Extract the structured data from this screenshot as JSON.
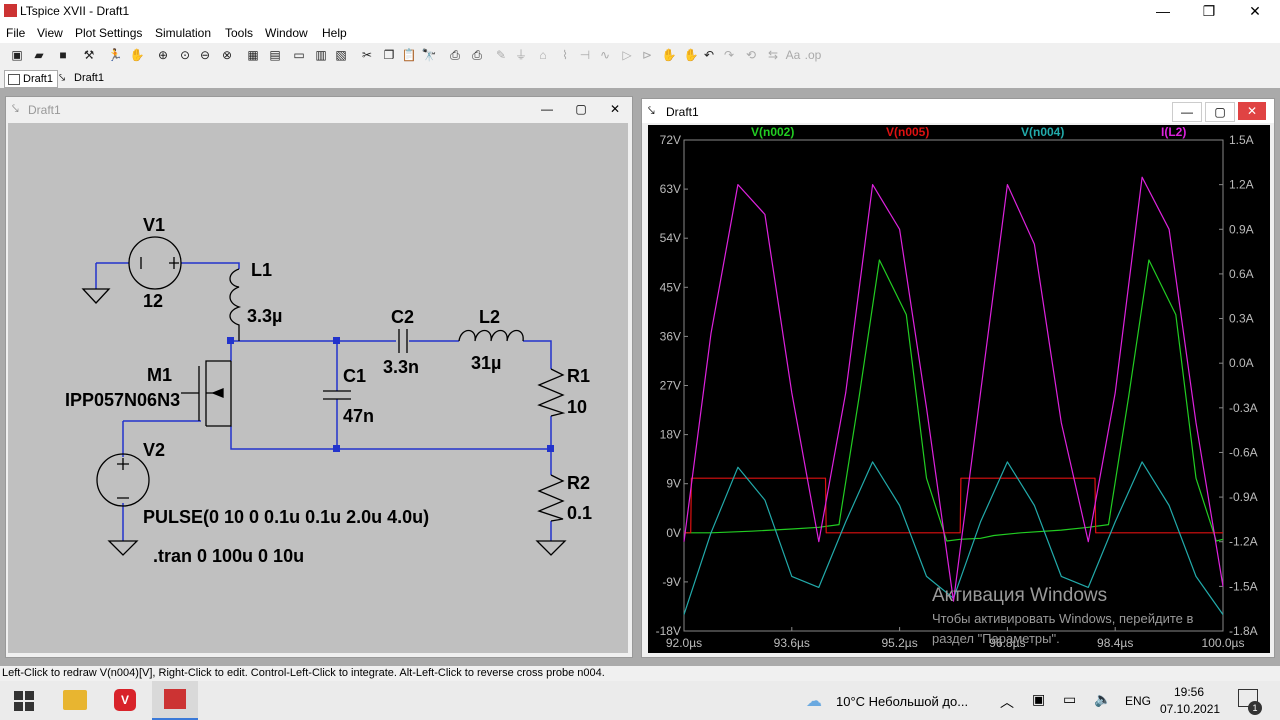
{
  "window": {
    "title": "LTspice XVII - Draft1",
    "min": "—",
    "max": "❐",
    "close": "✕"
  },
  "menu": [
    "File",
    "View",
    "Plot Settings",
    "Simulation",
    "Tools",
    "Window",
    "Help"
  ],
  "tabs": [
    "Draft1",
    "Draft1"
  ],
  "schematic_window": {
    "title": "Draft1",
    "min": "—",
    "max": "▢",
    "close": "✕"
  },
  "schematic": {
    "v1": {
      "name": "V1",
      "value": "12"
    },
    "l1": {
      "name": "L1",
      "value": "3.3µ"
    },
    "c2": {
      "name": "C2",
      "value": "3.3n"
    },
    "l2": {
      "name": "L2",
      "value": "31µ"
    },
    "m1": {
      "name": "M1",
      "value": "IPP057N06N3"
    },
    "c1": {
      "name": "C1",
      "value": "47n"
    },
    "r1": {
      "name": "R1",
      "value": "10"
    },
    "v2": {
      "name": "V2",
      "value": "PULSE(0 10 0 0.1u 0.1u 2.0u 4.0u)"
    },
    "r2": {
      "name": "R2",
      "value": "0.1"
    },
    "directive": ".tran 0 100u 0 10u"
  },
  "plot_window": {
    "title": "Draft1",
    "min": "—",
    "max": "▢",
    "close": "✕"
  },
  "chart_data": {
    "type": "line",
    "title": "",
    "xlabel": "",
    "ylabel": "",
    "xlim": [
      92.0,
      100.0
    ],
    "ylim": [
      -18,
      72
    ],
    "y2lim": [
      -1.8,
      1.5
    ],
    "x_ticks": [
      "92.0µs",
      "93.6µs",
      "95.2µs",
      "96.8µs",
      "98.4µs",
      "100.0µs"
    ],
    "y_ticks": [
      "72V",
      "63V",
      "54V",
      "45V",
      "36V",
      "27V",
      "18V",
      "9V",
      "0V",
      "-9V",
      "-18V"
    ],
    "y2_ticks": [
      "1.5A",
      "1.2A",
      "0.9A",
      "0.6A",
      "0.3A",
      "0.0A",
      "-0.3A",
      "-0.6A",
      "-0.9A",
      "-1.2A",
      "-1.5A",
      "-1.8A"
    ],
    "grid": false,
    "legend": "top",
    "series": [
      {
        "name": "V(n002)",
        "color": "#22cc22",
        "axis": "left",
        "x": [
          92.0,
          92.4,
          93.0,
          93.6,
          94.0,
          94.3,
          94.6,
          94.9,
          95.3,
          95.6,
          95.9,
          96.1,
          96.4,
          96.6,
          97.0,
          97.6,
          98.0,
          98.3,
          98.6,
          98.9,
          99.3,
          99.6,
          99.9,
          100.0
        ],
        "values": [
          0,
          0,
          0.3,
          0.7,
          1.0,
          1.5,
          25,
          50,
          40,
          10,
          -1.5,
          -1.2,
          -1.0,
          -0.5,
          0,
          0.5,
          1.0,
          1.5,
          25,
          50,
          40,
          10,
          -1.5,
          -1.2
        ]
      },
      {
        "name": "V(n005)",
        "color": "#dd1111",
        "axis": "left",
        "x": [
          92.0,
          92.1,
          92.11,
          94.1,
          94.11,
          96.1,
          96.11,
          98.1,
          98.11,
          100.0
        ],
        "values": [
          0,
          0,
          10,
          10,
          0,
          0,
          10,
          10,
          0,
          0
        ]
      },
      {
        "name": "V(n004)",
        "color": "#22aaaa",
        "axis": "left",
        "x": [
          92.0,
          92.4,
          92.8,
          93.2,
          93.6,
          94.0,
          94.4,
          94.8,
          95.2,
          95.6,
          96.0,
          96.4,
          96.8,
          97.2,
          97.6,
          98.0,
          98.4,
          98.8,
          99.2,
          99.6,
          100.0
        ],
        "values": [
          -15,
          0,
          12,
          6,
          -8,
          -10,
          2,
          13,
          5,
          -8,
          -12,
          2,
          13,
          5,
          -8,
          -10,
          2,
          13,
          5,
          -8,
          -15
        ]
      },
      {
        "name": "I(L2)",
        "color": "#dd22dd",
        "axis": "right",
        "x": [
          92.0,
          92.4,
          92.8,
          93.2,
          93.6,
          94.0,
          94.4,
          94.8,
          95.2,
          95.6,
          96.0,
          96.4,
          96.8,
          97.2,
          97.6,
          98.0,
          98.4,
          98.8,
          99.2,
          99.6,
          100.0
        ],
        "values": [
          -1.2,
          0.2,
          1.2,
          1.0,
          -0.2,
          -1.2,
          -0.2,
          1.2,
          0.9,
          -0.3,
          -1.6,
          -0.2,
          1.2,
          0.8,
          -0.4,
          -1.2,
          -0.2,
          1.25,
          0.9,
          -0.4,
          -1.5
        ]
      }
    ]
  },
  "watermark": {
    "line1": "Активация Windows",
    "line2": "Чтобы активировать Windows, перейдите в",
    "line3": "раздел \"Параметры\"."
  },
  "status": "Left-Click to redraw V(n004)[V],  Right-Click to edit. Control-Left-Click to integrate. Alt-Left-Click to reverse cross probe n004.",
  "taskbar": {
    "weather": "10°C  Небольшой до...",
    "lang": "ENG",
    "time": "19:56",
    "date": "07.10.2021",
    "notif": "1"
  }
}
